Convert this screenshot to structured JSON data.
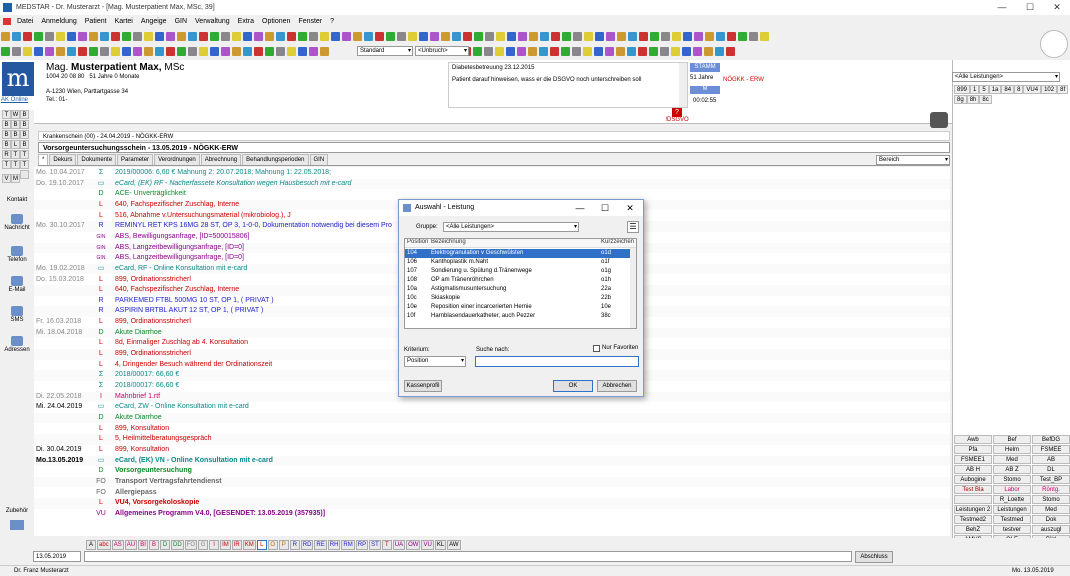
{
  "app": {
    "title": "MEDSTAR - Dr. Musterarzt - [Mag. Musterpatient Max, MSc, 39]"
  },
  "menu": [
    "Datei",
    "Anmeldung",
    "Patient",
    "Kartei",
    "Angeige",
    "GIN",
    "Verwaltung",
    "Extra",
    "Optionen",
    "Fenster",
    "?"
  ],
  "toolbar": {
    "style_select": "Standard",
    "wrap_select": "<Unbruch>"
  },
  "patient": {
    "title": "Mag.",
    "name": "Musterpatient Max,",
    "suffix": "MSc",
    "svnr": "1004 20 08 80",
    "age_text": "51 Jahre 0 Monate",
    "address": "A-1230 Wien, Parttartgasse 34",
    "tel": "Tel.: 01-",
    "aklink": "AK Online"
  },
  "notes": {
    "line1": "Diabetesbetreuung 23.12.2015",
    "line2": "Patient darauf hinweisen, wass er die DSGVO noch unterschreiben soll"
  },
  "stamm": {
    "label": "STAMM",
    "age": "51 Jahre",
    "kasse": "NÖGKK - ERW",
    "m": "M",
    "time": "00:02:55",
    "dsgvo": "!DSGVO",
    "q": "?"
  },
  "leftgrid": [
    "T",
    "W",
    "B",
    "B",
    "B",
    "B",
    "B",
    "B",
    "B",
    "B",
    "L",
    "B",
    "R",
    "T",
    "T",
    "T",
    "T",
    "T",
    "V",
    "M",
    ""
  ],
  "leftnav": [
    "Kontakt",
    "Nachricht",
    "Telefon",
    "E-Mail",
    "SMS",
    "Adressen"
  ],
  "leftbottom": {
    "zubehor": "Zubehör"
  },
  "krankenschein": "Krankenschein (00) - 24.04.2019 - NÖGKK-ERW",
  "vorsorge": "Vorsorgeuntersuchungsschein - 13.05.2019 - NÖGKK-ERW",
  "tabs": [
    "*",
    "Dekurs",
    "Dokumente",
    "Parameter",
    "Verordnungen",
    "Abrechnung",
    "Behandlungsperioden",
    "GIN"
  ],
  "bereich": "Bereich",
  "journal": [
    {
      "d": "Mo. 10.04.2017",
      "c": "Σ",
      "x": "2019/00006: 6,60 € Mahnung 2: 20.07.2018; Mahnung 1: 22.05.2018;",
      "col": "#0a8a8a",
      "dc": "#888"
    },
    {
      "d": "Do. 19.10.2017",
      "c": "▭",
      "x": "eCard, (EK) RF - Nacherfassete Konsultation wegen Hausbesuch mit e-card",
      "col": "#0a8a8a",
      "dc": "#888",
      "it": true
    },
    {
      "d": "",
      "c": "D",
      "x": "ACE- Unverträglichkeit",
      "col": "#0a8a2a"
    },
    {
      "d": "",
      "c": "L",
      "x": "640, Fachspezifischer Zuschlag, Interne",
      "col": "#c00"
    },
    {
      "d": "",
      "c": "L",
      "x": "516, Abnahme v.Untersuchungsmaterial (mikrobiolog.), J",
      "col": "#c00"
    },
    {
      "d": "Mo. 30.10.2017",
      "c": "R",
      "x": "REMINYL RET KPS 16MG 28 ST, OP 3, 1-0-0, Dokumentation notwendig bei diesem Pro",
      "col": "#22c",
      "dc": "#888"
    },
    {
      "d": "",
      "c": "GIN",
      "x": "ABS, Bewilligungsanfrage, [ID=500015806]",
      "col": "#808"
    },
    {
      "d": "",
      "c": "GIN",
      "x": "ABS, Langzeitbewilligungsanfrage, [ID=0]",
      "col": "#808"
    },
    {
      "d": "",
      "c": "GIN",
      "x": "ABS, Langzeitbewilligungsanfrage, [ID=0]",
      "col": "#808"
    },
    {
      "d": "Mo. 19.02.2018",
      "c": "▭",
      "x": "eCard, RF - Online Konsultation mit e-card",
      "col": "#0a8a8a",
      "dc": "#888"
    },
    {
      "d": "Do. 15.03.2018",
      "c": "L",
      "x": "899, Ordinationsstricherl",
      "col": "#c00",
      "dc": "#888"
    },
    {
      "d": "",
      "c": "L",
      "x": "640, Fachspezifischer Zuschlag, Interne",
      "col": "#c00"
    },
    {
      "d": "",
      "c": "R",
      "x": "PARKEMED FTBL 500MG 10 ST, OP 1, ( PRIVAT )",
      "col": "#22c"
    },
    {
      "d": "",
      "c": "R",
      "x": "ASPIRIN BRTBL AKUT 12 ST, OP 1, ( PRIVAT )",
      "col": "#22c"
    },
    {
      "d": "Fr. 16.03.2018",
      "c": "L",
      "x": "899, Ordinationsstricherl",
      "col": "#c00",
      "dc": "#888"
    },
    {
      "d": "Mi. 18.04.2018",
      "c": "D",
      "x": "Akute Diarrhoe",
      "col": "#0a8a2a",
      "dc": "#888"
    },
    {
      "d": "",
      "c": "L",
      "x": "8d, Einmaliger Zuschlag ab 4. Konsultation",
      "col": "#c00"
    },
    {
      "d": "",
      "c": "L",
      "x": "899, Ordinationsstricherl",
      "col": "#c00"
    },
    {
      "d": "",
      "c": "L",
      "x": "4, Dringender Besuch während der Ordinationszeit",
      "col": "#c00"
    },
    {
      "d": "",
      "c": "Σ",
      "x": "2018/00017: 66,60 €",
      "col": "#0a8a8a"
    },
    {
      "d": "",
      "c": "Σ",
      "x": "2018/00017: 66,60 €",
      "col": "#0a8a8a"
    },
    {
      "d": "Di. 22.05.2018",
      "c": "I",
      "x": "Mahnbrief 1.rtf",
      "col": "#c06",
      "dc": "#888"
    },
    {
      "d": "Mi. 24.04.2019",
      "c": "▭",
      "x": "eCard, ZW - Online Konsultation mit e-card",
      "col": "#0a8a8a",
      "dc": "#000"
    },
    {
      "d": "",
      "c": "D",
      "x": "Akute Diarrhoe",
      "col": "#0a8a2a"
    },
    {
      "d": "",
      "c": "L",
      "x": "899, Konsultation",
      "col": "#c00"
    },
    {
      "d": "",
      "c": "L",
      "x": "5, Heilmittelberatungsgespräch",
      "col": "#c00"
    },
    {
      "d": "Di. 30.04.2019",
      "c": "L",
      "x": "899, Konsultation",
      "col": "#c00",
      "dc": "#000"
    },
    {
      "d": "Mo.13.05.2019",
      "c": "▭",
      "x": "eCard, (EK) VN - Online Konsultation mit e-card",
      "col": "#0a8a8a",
      "dc": "#000",
      "b": true
    },
    {
      "d": "",
      "c": "D",
      "x": "Vorsorgeuntersuchung",
      "col": "#0a8a2a",
      "b": true
    },
    {
      "d": "",
      "c": "FO",
      "x": "Transport Vertragsfahrtendienst",
      "col": "#666",
      "b": true
    },
    {
      "d": "",
      "c": "FO",
      "x": "Allergiepass",
      "col": "#666",
      "b": true
    },
    {
      "d": "",
      "c": "L",
      "x": "VU4, Vorsorgekoloskopie",
      "col": "#c00",
      "b": true
    },
    {
      "d": "",
      "c": "VU",
      "x": "Allgemeines Programm V4.0, [GESENDET: 13.05.2019 (357935)]",
      "col": "#808",
      "b": true
    }
  ],
  "dialog": {
    "title": "Auswahl - Leistung",
    "gruppe_label": "Gruppe:",
    "gruppe_value": "<Alle Leistungen>",
    "col_position": "Position",
    "col_bez": "Bezeichnung",
    "col_kurz": "Kurzzeichen",
    "rows": [
      {
        "p": "104",
        "b": "Elektrogranulation v Geschwülsten",
        "k": "o1d"
      },
      {
        "p": "106",
        "b": "Kanthoplastik m.Naht",
        "k": "o1f"
      },
      {
        "p": "107",
        "b": "Sondierung u. Spülung d.Tränenwege",
        "k": "o1g"
      },
      {
        "p": "108",
        "b": "OP am Tränenröhrchen",
        "k": "o1h"
      },
      {
        "p": "10a",
        "b": "Astigmatismusuntersuchung",
        "k": "22a"
      },
      {
        "p": "10c",
        "b": "Skiaskopie",
        "k": "22b"
      },
      {
        "p": "10e",
        "b": "Reposition einer incarcerierten Hernie",
        "k": "10e"
      },
      {
        "p": "10f",
        "b": "Harnblasendauerkatheter, auch Pezzer",
        "k": "38c"
      }
    ],
    "kriterium_label": "Kriterium:",
    "kriterium_value": "Position",
    "suche_label": "Suche nach:",
    "suche_value": "",
    "nur_favoriten": "Nur Favoriten",
    "kassenprofil": "Kassenprofil",
    "ok": "OK",
    "abbrechen": "Abbrechen"
  },
  "right": {
    "select": "<Alle Leistungen>",
    "nums": [
      "899",
      "1",
      "5",
      "1a",
      "84",
      "8",
      "VU4",
      "102",
      "8f",
      "8g",
      "8h",
      "8c"
    ],
    "grid": [
      "Awb",
      "Bef",
      "BefDG",
      "Pfa",
      "Helm",
      "FSMEE",
      "FSMEE1",
      "Med",
      "AB",
      "AB H",
      "AB Z",
      "DL",
      "Aubogine",
      "Stomo",
      "Test_BP",
      "Test Bla",
      "Labor",
      "Röntg.",
      "",
      "R_Loette",
      "Stomo",
      "Leistungen 2",
      "Leistungen",
      "Med",
      "Testmed2",
      "Testmed",
      "Dok",
      "BehZ",
      "testver",
      "auszugl",
      "AMVS",
      "OLE",
      "Bild"
    ]
  },
  "bottombar": [
    "A",
    "abc",
    "AS",
    "AU",
    "BI",
    "B",
    "D",
    "DD",
    "FO",
    "G",
    "I",
    "IM",
    "IR",
    "KM",
    "L",
    "O",
    "P",
    "R",
    "RD",
    "RE",
    "RH",
    "RM",
    "RP",
    "ST",
    "T",
    "UA",
    "OW",
    "VU",
    "KL",
    "AW"
  ],
  "cmd": {
    "date": "13.05.2019",
    "abschluss": "Abschluss"
  },
  "status": {
    "user": "Dr. Franz Musterarzt",
    "date": "Mo. 13.05.2019"
  }
}
